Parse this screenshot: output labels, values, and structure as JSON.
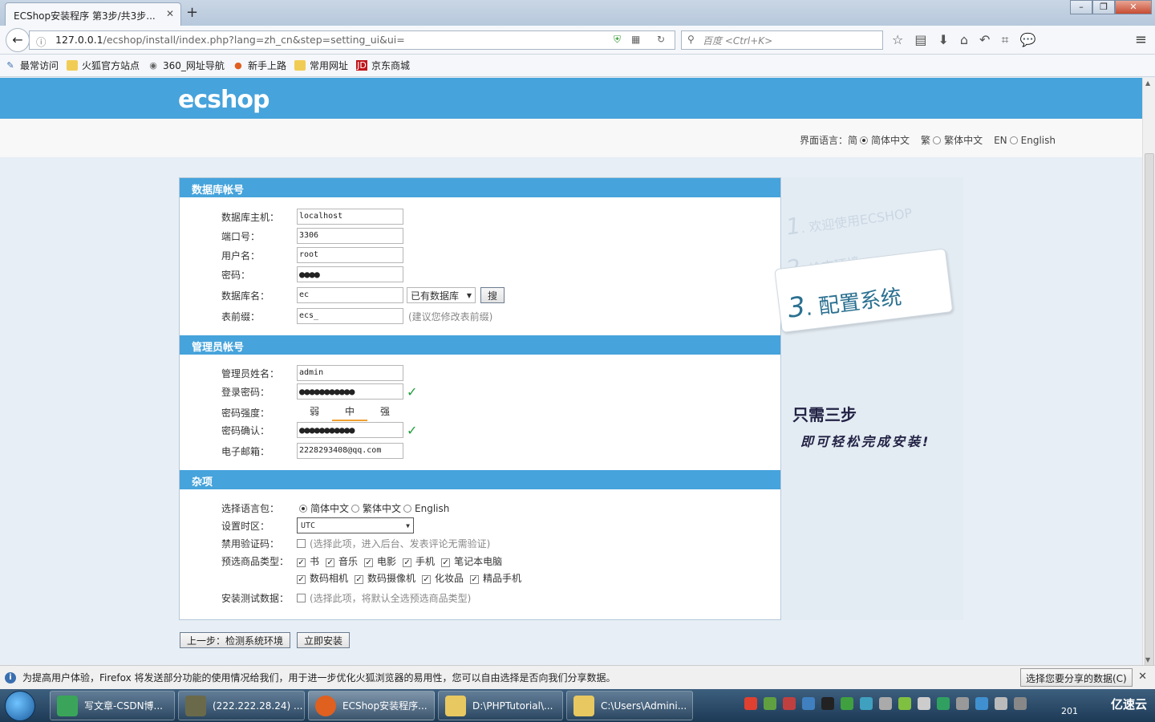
{
  "browser": {
    "tab_title": "ECShop安装程序 第3步/共3步...",
    "url_host": "127.0.0.1",
    "url_path": "/ecshop/install/index.php?lang=zh_cn&step=setting_ui&ui=",
    "search_placeholder": "百度 <Ctrl+K>",
    "bookmarks": [
      "最常访问",
      "火狐官方站点",
      "360_网址导航",
      "新手上路",
      "常用网址",
      "京东商城"
    ]
  },
  "header": {
    "logo": "ecshop"
  },
  "language_bar": {
    "label": "界面语言：",
    "options": [
      {
        "prefix": "简",
        "label": "简体中文",
        "selected": true
      },
      {
        "prefix": "繁",
        "label": "繁体中文",
        "selected": false
      },
      {
        "prefix": "EN",
        "label": "English",
        "selected": false
      }
    ]
  },
  "db_section": {
    "title": "数据库帐号",
    "host_label": "数据库主机：",
    "host_value": "localhost",
    "port_label": "端口号：",
    "port_value": "3306",
    "user_label": "用户名：",
    "user_value": "root",
    "password_label": "密码：",
    "password_value": "●●●●",
    "dbname_label": "数据库名：",
    "dbname_value": "ec",
    "existing_db_select": "已有数据库",
    "search_button": "搜",
    "prefix_label": "表前缀：",
    "prefix_value": "ecs_",
    "prefix_hint": "(建议您修改表前缀)"
  },
  "admin_section": {
    "title": "管理员帐号",
    "name_label": "管理员姓名：",
    "name_value": "admin",
    "password_label": "登录密码：",
    "password_value": "●●●●●●●●●●●",
    "strength_label": "密码强度：",
    "strength_levels": [
      "弱",
      "中",
      "强"
    ],
    "strength_current": "中",
    "confirm_label": "密码确认：",
    "confirm_value": "●●●●●●●●●●●",
    "email_label": "电子邮箱：",
    "email_value": "2228293408@qq.com"
  },
  "misc_section": {
    "title": "杂项",
    "langpack_label": "选择语言包：",
    "langpack_options": [
      {
        "label": "简体中文",
        "selected": true
      },
      {
        "label": "繁体中文",
        "selected": false
      },
      {
        "label": "English",
        "selected": false
      }
    ],
    "timezone_label": "设置时区：",
    "timezone_value": "UTC",
    "captcha_label": "禁用验证码：",
    "captcha_hint": "(选择此项，进入后台、发表评论无需验证)",
    "goods_label": "预选商品类型：",
    "goods_types_row1": [
      "书",
      "音乐",
      "电影",
      "手机",
      "笔记本电脑"
    ],
    "goods_types_row2": [
      "数码相机",
      "数码摄像机",
      "化妆品",
      "精品手机"
    ],
    "testdata_label": "安装测试数据：",
    "testdata_hint": "(选择此项，将默认全选预选商品类型)"
  },
  "steps": {
    "step1_num": "1",
    "step1": ". 欢迎使用ECSHOP",
    "step2_num": "2",
    "step2": ". 检查环境",
    "step3_num": "3",
    "step3": ". 配置系统",
    "slogan1": "只需三步",
    "slogan2": "即可轻松完成安装!"
  },
  "buttons": {
    "prev": "上一步：检测系统环境",
    "install": "立即安装"
  },
  "notification": {
    "text": "为提高用户体验，Firefox 将发送部分功能的使用情况给我们，用于进一步优化火狐浏览器的易用性，您可以自由选择是否向我们分享数据。",
    "share_button": "选择您要分享的数据(C)"
  },
  "taskbar": {
    "tasks": [
      "写文章-CSDN博...",
      "(222.222.28.24) ...",
      "ECShop安装程序...",
      "D:\\PHPTutorial\\...",
      "C:\\Users\\Admini..."
    ],
    "clock": "201",
    "brand": "亿速云"
  }
}
